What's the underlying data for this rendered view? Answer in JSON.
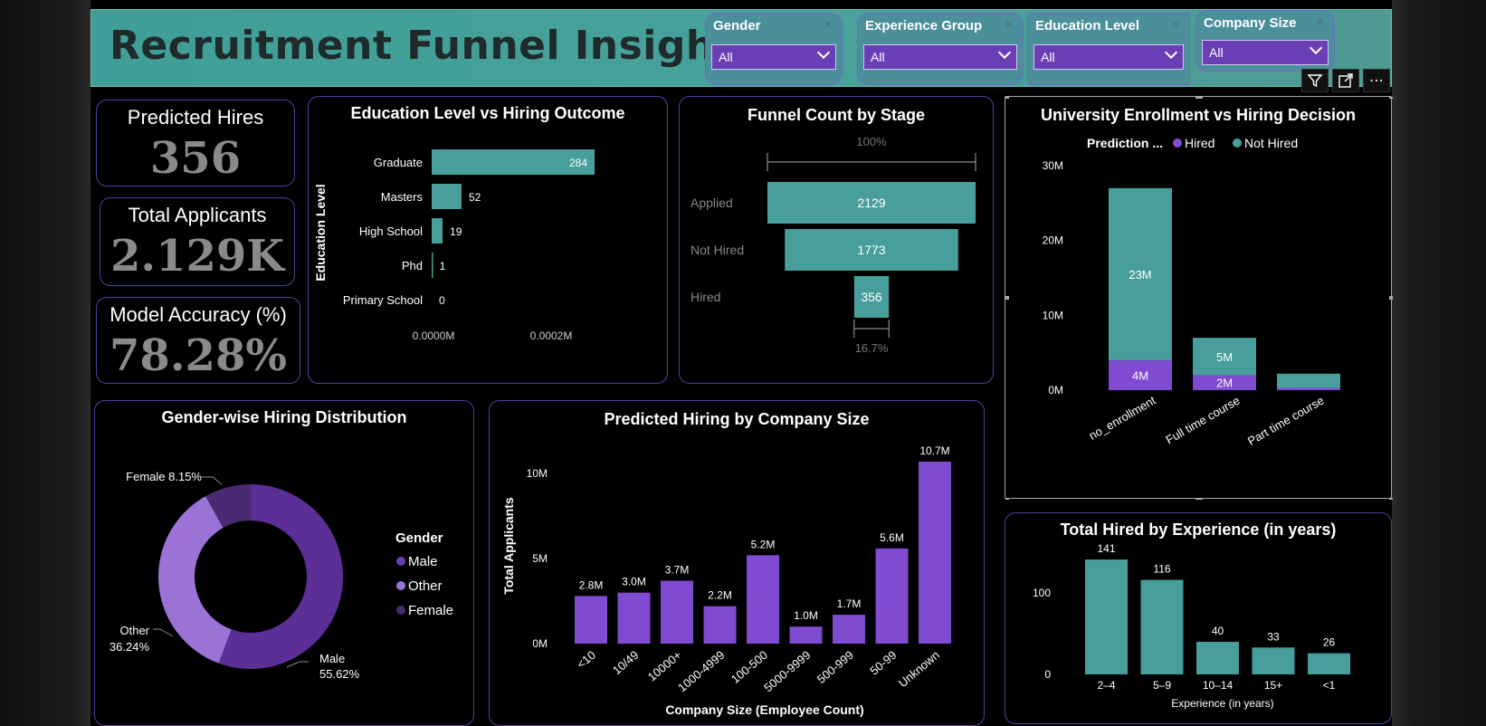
{
  "dashboard": {
    "title": "Recruitment Funnel Insights",
    "slicers": [
      {
        "label": "Gender",
        "value": "All"
      },
      {
        "label": "Experience Group",
        "value": "All"
      },
      {
        "label": "Education Level",
        "value": "All"
      },
      {
        "label": "Company Size",
        "value": "All"
      }
    ],
    "kpis": [
      {
        "label": "Predicted Hires",
        "value": "356"
      },
      {
        "label": "Total Applicants",
        "value": "2.129K"
      },
      {
        "label": "Model Accuracy (%)",
        "value": "78.28%"
      }
    ],
    "icons": [
      "filter-icon",
      "focus-mode-icon",
      "more-options-icon"
    ]
  },
  "colors": {
    "teal": "#479e9a",
    "purple": "#7f4bd0",
    "purple_dark": "#5b2f96",
    "purple_mid": "#6a3fb5",
    "purple_light": "#9b73d6"
  },
  "chart_data": [
    {
      "id": "education",
      "type": "bar",
      "orientation": "horizontal",
      "title": "Education Level vs Hiring Outcome",
      "ylabel": "Education Level",
      "categories": [
        "Graduate",
        "Masters",
        "High School",
        "Phd",
        "Primary School"
      ],
      "values": [
        284,
        52,
        19,
        1,
        0
      ],
      "x_ticks": [
        "0.0000M",
        "0.0002M"
      ]
    },
    {
      "id": "funnel",
      "type": "bar",
      "subtype": "funnel",
      "title": "Funnel Count by Stage",
      "categories": [
        "Applied",
        "Not Hired",
        "Hired"
      ],
      "values": [
        2129,
        1773,
        356
      ],
      "top_label": "100%",
      "bottom_label": "16.7%"
    },
    {
      "id": "university",
      "type": "bar",
      "subtype": "stacked",
      "title": "University Enrollment vs Hiring Decision",
      "legend_title": "Prediction ...",
      "categories": [
        "no_enrollment",
        "Full time course",
        "Part time course"
      ],
      "series": [
        {
          "name": "Hired",
          "values": [
            4,
            2,
            0.3
          ],
          "labels": [
            "4M",
            "2M",
            ""
          ]
        },
        {
          "name": "Not Hired",
          "values": [
            23,
            5,
            1.9
          ],
          "labels": [
            "23M",
            "5M",
            ""
          ]
        }
      ],
      "y_ticks": [
        "0M",
        "10M",
        "20M",
        "30M"
      ],
      "ylim": [
        0,
        30
      ]
    },
    {
      "id": "gender",
      "type": "pie",
      "subtype": "donut",
      "title": "Gender-wise Hiring Distribution",
      "legend_title": "Gender",
      "slices": [
        {
          "name": "Male",
          "value": 55.62,
          "label": "55.62%"
        },
        {
          "name": "Other",
          "value": 36.24,
          "label": "36.24%"
        },
        {
          "name": "Female",
          "value": 8.15,
          "label": "8.15%"
        }
      ]
    },
    {
      "id": "company",
      "type": "bar",
      "title": "Predicted Hiring by Company Size",
      "xlabel": "Company Size (Employee Count)",
      "ylabel": "Total Applicants",
      "categories": [
        "<10",
        "10/49",
        "10000+",
        "1000-4999",
        "100-500",
        "5000-9999",
        "500-999",
        "50-99",
        "Unknown"
      ],
      "values": [
        2.8,
        3.0,
        3.7,
        2.2,
        5.2,
        1.0,
        1.7,
        5.6,
        10.7
      ],
      "labels": [
        "2.8M",
        "3.0M",
        "3.7M",
        "2.2M",
        "5.2M",
        "1.0M",
        "1.7M",
        "5.6M",
        "10.7M"
      ],
      "y_ticks": [
        "0M",
        "5M",
        "10M"
      ],
      "ylim": [
        0,
        11.5
      ]
    },
    {
      "id": "experience",
      "type": "bar",
      "title": "Total Hired by Experience (in years)",
      "xlabel": "Experience (in years)",
      "categories": [
        "2–4",
        "5–9",
        "10–14",
        "15+",
        "<1"
      ],
      "values": [
        141,
        116,
        40,
        33,
        26
      ],
      "y_ticks": [
        "0",
        "100"
      ],
      "ylim": [
        0,
        160
      ]
    }
  ]
}
